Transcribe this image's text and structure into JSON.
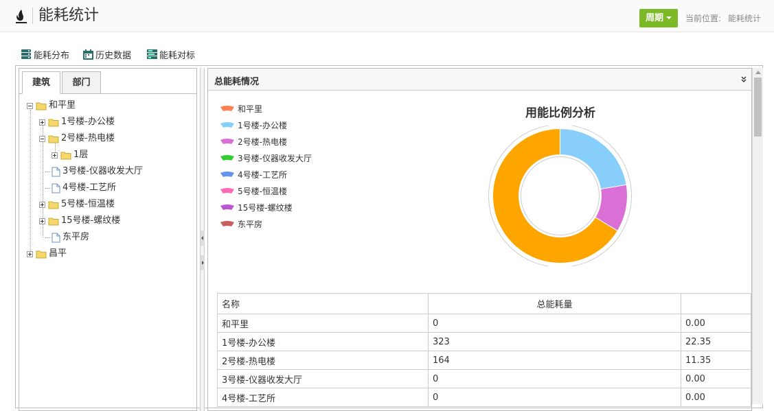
{
  "header": {
    "title": "能耗统计",
    "period_button": "周期",
    "breadcrumb_label": "当前位置:",
    "breadcrumb_current": "能耗统计"
  },
  "toolbar": {
    "items": [
      {
        "label": "能耗分布",
        "icon": "distribution-icon"
      },
      {
        "label": "历史数据",
        "icon": "calendar-icon"
      },
      {
        "label": "能耗对标",
        "icon": "benchmark-icon"
      }
    ]
  },
  "tabs": [
    {
      "label": "建筑",
      "active": true
    },
    {
      "label": "部门",
      "active": false
    }
  ],
  "tree": [
    {
      "label": "和平里",
      "level": 0,
      "expander": "minus",
      "icon": "folder"
    },
    {
      "label": "1号楼-办公楼",
      "level": 1,
      "expander": "plus",
      "icon": "folder"
    },
    {
      "label": "2号楼-热电楼",
      "level": 1,
      "expander": "minus",
      "icon": "folder"
    },
    {
      "label": "1层",
      "level": 2,
      "expander": "plus",
      "icon": "folder"
    },
    {
      "label": "3号楼-仪器收发大厅",
      "level": 1,
      "expander": "none",
      "icon": "file"
    },
    {
      "label": "4号楼-工艺所",
      "level": 1,
      "expander": "none",
      "icon": "file"
    },
    {
      "label": "5号楼-恒温楼",
      "level": 1,
      "expander": "plus",
      "icon": "folder"
    },
    {
      "label": "15号楼-螺纹楼",
      "level": 1,
      "expander": "plus",
      "icon": "folder"
    },
    {
      "label": "东平房",
      "level": 1,
      "expander": "none",
      "icon": "file"
    },
    {
      "label": "昌平",
      "level": 0,
      "expander": "plus",
      "icon": "folder"
    }
  ],
  "panel": {
    "title": "总能耗情况"
  },
  "chart_data": {
    "type": "pie",
    "title": "用能比例分析",
    "legend_placement": "left",
    "series": [
      {
        "name": "和平里",
        "value": 0,
        "color": "#ff7f50"
      },
      {
        "name": "1号楼-办公楼",
        "value": 323,
        "color": "#87cefa"
      },
      {
        "name": "2号楼-热电楼",
        "value": 164,
        "color": "#da70d6"
      },
      {
        "name": "3号楼-仪器收发大厅",
        "value": 0,
        "color": "#32cd32"
      },
      {
        "name": "4号楼-工艺所",
        "value": 0,
        "color": "#6495ed"
      },
      {
        "name": "5号楼-恒温楼",
        "value": 0,
        "color": "#ff69b4"
      },
      {
        "name": "15号楼-螺纹楼",
        "value": 0,
        "color": "#ba55d3"
      },
      {
        "name": "东平房",
        "value": 0,
        "color": "#cd5c5c"
      }
    ],
    "remainder": {
      "value": 958,
      "color": "#ffa500"
    }
  },
  "table": {
    "headers": [
      "名称",
      "总能耗量",
      ""
    ],
    "rows": [
      [
        "和平里",
        "0",
        "0.00"
      ],
      [
        "1号楼-办公楼",
        "323",
        "22.35"
      ],
      [
        "2号楼-热电楼",
        "164",
        "11.35"
      ],
      [
        "3号楼-仪器收发大厅",
        "0",
        "0.00"
      ],
      [
        "4号楼-工艺所",
        "0",
        "0.00"
      ]
    ]
  },
  "colors": {
    "accent_green": "#7cb926"
  }
}
